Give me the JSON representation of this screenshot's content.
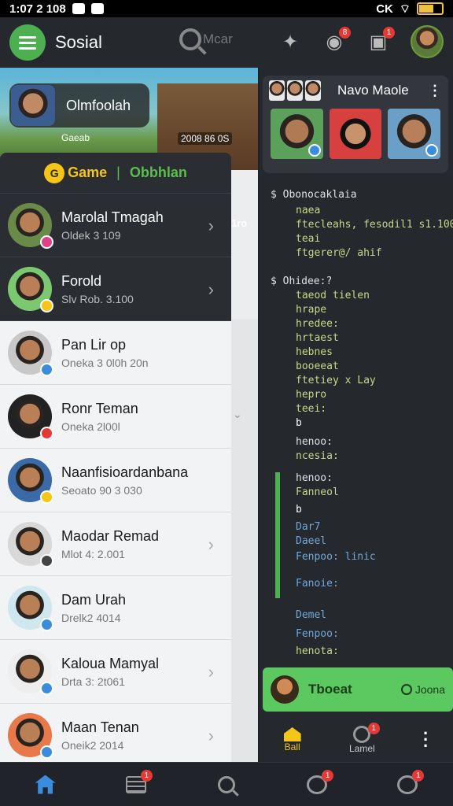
{
  "status": {
    "time": "1:07 2 108",
    "right_text": "CK"
  },
  "app": {
    "title": "Sosial",
    "search_placeholder": "Mcar"
  },
  "top_badges": {
    "notif": "8",
    "chat": "1"
  },
  "banner": {
    "name": "Olmfoolah",
    "sub": "Gaeab",
    "stat": "2008 86 0S",
    "stat2": "1ro"
  },
  "drawer": {
    "coin": "G",
    "game_label": "Game",
    "separator": "|",
    "tab_label": "Obbhlan"
  },
  "contacts": [
    {
      "name": "Marolal Tmagah",
      "sub": "Oldek 3 109",
      "fb": "#e0408a"
    },
    {
      "name": "Forold",
      "sub": "Slv Rob. 3.100",
      "fb": "#f5c518"
    },
    {
      "name": "Pan Lir op",
      "sub": "Oneka 3 0l0h 20n",
      "fb": "#3a8dde"
    },
    {
      "name": "Ronr Teman",
      "sub": "Oneka 2l00l",
      "fb": "#e53935"
    },
    {
      "name": "Naanfisioardanbana",
      "sub": "Seoato 90 3 030",
      "fb": "#f5c518"
    },
    {
      "name": "Maodar Remad",
      "sub": "Mlot 4: 2.001",
      "fb": "#444444"
    },
    {
      "name": "Dam Urah",
      "sub": "Drelk2 4014",
      "fb": "#3a8dde"
    },
    {
      "name": "Kaloua Mamyal",
      "sub": "Drta 3: 2t061",
      "fb": "#3a8dde"
    },
    {
      "name": "Maan Tenan",
      "sub": "Oneik2 2014",
      "fb": "#3a8dde"
    }
  ],
  "right_card": {
    "title": "Navo Maole",
    "menu": "⋮"
  },
  "code_lines": [
    {
      "t": "$ Obonocaklaia"
    },
    {
      "t": "naea"
    },
    {
      "t": "ftecleahs, fesodil1 s1.100"
    },
    {
      "t": "teai"
    },
    {
      "t": "ftgerer@/ ahif"
    },
    {
      "t": "$ Ohidee:?"
    },
    {
      "t": "taeod tielen"
    },
    {
      "t": "hrape"
    },
    {
      "t": "hredee:"
    },
    {
      "t": "hrtaest"
    },
    {
      "t": "hebnes"
    },
    {
      "t": "booeeat"
    },
    {
      "t": "ftetiey x Lay"
    },
    {
      "t": "hepro"
    },
    {
      "t": "teei:"
    },
    {
      "t": "b"
    },
    {
      "t": "henoo:"
    },
    {
      "t": "ncesia:"
    },
    {
      "t": "henoo:"
    },
    {
      "t": "Fanneol"
    },
    {
      "t": "b"
    },
    {
      "t": "Dar7"
    },
    {
      "t": "Daeel"
    },
    {
      "t": "Fenpoo: linic"
    },
    {
      "t": "Fanoie:"
    },
    {
      "t": "Demel"
    },
    {
      "t": "Fenpoo:"
    },
    {
      "t": "henota:"
    }
  ],
  "toast": {
    "title": "Tboeat",
    "action": "Joona"
  },
  "right_nav": {
    "home": "Ball",
    "chat": "Lamel",
    "chat_badge": "1"
  },
  "bottom_badges": {
    "list": "1",
    "inbox": "1",
    "chat": "1"
  }
}
